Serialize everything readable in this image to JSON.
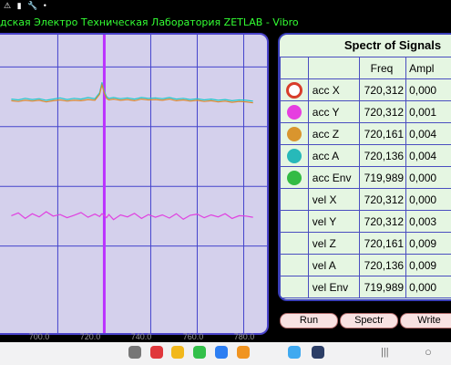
{
  "window": {
    "title": "дская Электро Техническая Лаборатория ZETLAB - Vibro"
  },
  "statusbar": {
    "icons": "⚠ ▮ 🔧 •"
  },
  "plot": {
    "bg": "#d4d0ec",
    "marker_color": "#bb33ff",
    "xaxis_ticks": [
      "700.0",
      "720.0",
      "740.0",
      "760.0",
      "780.0"
    ]
  },
  "chart_data": {
    "type": "line",
    "x": [
      680,
      683,
      686,
      689,
      692,
      695,
      698,
      701,
      704,
      707,
      710,
      713,
      716,
      718,
      719,
      720,
      721,
      722,
      724,
      727,
      730,
      733,
      736,
      739,
      742,
      745,
      748,
      751,
      754,
      757,
      760,
      763,
      766,
      769,
      772,
      775,
      778,
      781,
      784
    ],
    "series": [
      {
        "color": "#1fc8c8",
        "values": [
          -0.12,
          -0.14,
          -0.1,
          -0.13,
          -0.11,
          -0.15,
          -0.12,
          -0.09,
          -0.13,
          -0.1,
          -0.12,
          -0.08,
          -0.11,
          0.04,
          0.3,
          0.08,
          -0.06,
          -0.1,
          -0.08,
          -0.11,
          -0.09,
          -0.12,
          -0.08,
          -0.1,
          -0.09,
          -0.11,
          -0.08,
          -0.12,
          -0.1,
          -0.13,
          -0.11,
          -0.14,
          -0.12,
          -0.15,
          -0.13,
          -0.16,
          -0.14,
          -0.15,
          -0.17
        ]
      },
      {
        "color": "#d9892d",
        "values": [
          -0.16,
          -0.18,
          -0.15,
          -0.17,
          -0.15,
          -0.19,
          -0.16,
          -0.14,
          -0.17,
          -0.15,
          -0.16,
          -0.13,
          -0.15,
          0.0,
          0.24,
          0.04,
          -0.1,
          -0.14,
          -0.12,
          -0.15,
          -0.13,
          -0.16,
          -0.12,
          -0.14,
          -0.13,
          -0.15,
          -0.12,
          -0.16,
          -0.14,
          -0.17,
          -0.15,
          -0.18,
          -0.16,
          -0.19,
          -0.17,
          -0.2,
          -0.18,
          -0.19,
          -0.21
        ]
      },
      {
        "color": "#e040e0",
        "values": [
          -3.05,
          -2.98,
          -3.12,
          -3.0,
          -3.08,
          -2.95,
          -3.06,
          -3.02,
          -3.1,
          -3.04,
          -2.97,
          -3.09,
          -3.01,
          -3.07,
          -3.0,
          -3.04,
          -3.1,
          -3.02,
          -3.15,
          -3.03,
          -3.08,
          -2.99,
          -3.12,
          -3.02,
          -3.09,
          -3.03,
          -3.11,
          -3.0,
          -3.14,
          -3.04,
          -3.01,
          -3.1,
          -3.03,
          -3.08,
          -3.0,
          -3.12,
          -3.05,
          -3.06,
          -3.09
        ]
      }
    ],
    "xlim": [
      672,
      790
    ],
    "ylim": [
      -6,
      1.5
    ],
    "xticks": [
      "700.0",
      "720.0",
      "740.0",
      "760.0",
      "780.0"
    ],
    "grid": true,
    "marker_x": 720
  },
  "panel": {
    "title": "Spectr of Signals",
    "headers": {
      "freq": "Freq",
      "ampl": "Ampl"
    },
    "rows": [
      {
        "name": "acc X",
        "freq": "720,312",
        "ampl": "0,000",
        "icon": "ring",
        "color": "#d83d2a"
      },
      {
        "name": "acc Y",
        "freq": "720,312",
        "ampl": "0,001",
        "icon": "dot",
        "color": "#e63ee0"
      },
      {
        "name": "acc Z",
        "freq": "720,161",
        "ampl": "0,004",
        "icon": "dot",
        "color": "#d9952e"
      },
      {
        "name": "acc A",
        "freq": "720,136",
        "ampl": "0,004",
        "icon": "dot",
        "color": "#27b9b9"
      },
      {
        "name": "acc Env",
        "freq": "719,989",
        "ampl": "0,000",
        "icon": "dot",
        "color": "#33bb44"
      },
      {
        "name": "vel X",
        "freq": "720,312",
        "ampl": "0,000",
        "icon": "none",
        "color": ""
      },
      {
        "name": "vel Y",
        "freq": "720,312",
        "ampl": "0,003",
        "icon": "none",
        "color": ""
      },
      {
        "name": "vel Z",
        "freq": "720,161",
        "ampl": "0,009",
        "icon": "none",
        "color": ""
      },
      {
        "name": "vel A",
        "freq": "720,136",
        "ampl": "0,009",
        "icon": "none",
        "color": ""
      },
      {
        "name": "vel Env",
        "freq": "719,989",
        "ampl": "0,000",
        "icon": "none",
        "color": ""
      }
    ]
  },
  "buttons": {
    "run": "Run",
    "spectr": "Spectr",
    "write": "Write"
  },
  "navbar": {
    "apps": [
      {
        "icon": "apps-grid-icon",
        "color": "#777777"
      },
      {
        "icon": "red-app-icon",
        "color": "#e0383c"
      },
      {
        "icon": "yellow-app-icon",
        "color": "#f2b81c"
      },
      {
        "icon": "green-app-icon",
        "color": "#33c04a"
      },
      {
        "icon": "blue-chat-icon",
        "color": "#2d7ef2"
      },
      {
        "icon": "orange-app-icon",
        "color": "#f09420"
      },
      {
        "icon": "play-store-icon",
        "color": "#3fa9f0"
      },
      {
        "icon": "settings-icon",
        "color": "#2c3e66"
      }
    ],
    "recent": "|||",
    "home": "○"
  }
}
